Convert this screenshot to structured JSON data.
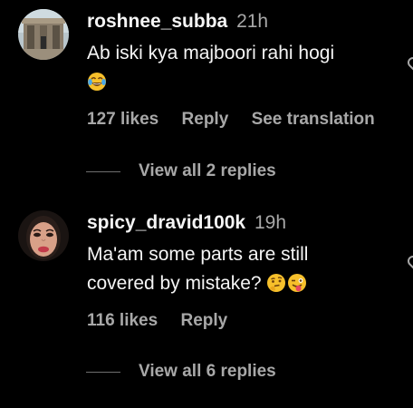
{
  "comments": [
    {
      "username": "roshnee_subba",
      "time": "21h",
      "text": "Ab iski kya majboori rahi hogi",
      "emojis": [
        "face-with-tears-of-joy"
      ],
      "likes": "127 likes",
      "reply_label": "Reply",
      "translate_label": "See translation",
      "view_replies": "View all 2 replies"
    },
    {
      "username": "spicy_dravid100k",
      "time": "19h",
      "text_line1": "Ma'am some parts are still",
      "text_line2": "covered by mistake?",
      "emojis": [
        "thinking-face",
        "winking-face-with-tongue"
      ],
      "likes": "116 likes",
      "reply_label": "Reply",
      "view_replies": "View all 6 replies"
    }
  ],
  "colors": {
    "background": "#000000",
    "primary_text": "#f5f5f5",
    "secondary_text": "#a8a8a8",
    "divider": "#6e6e6e"
  },
  "icons": [
    "heart-icon"
  ]
}
